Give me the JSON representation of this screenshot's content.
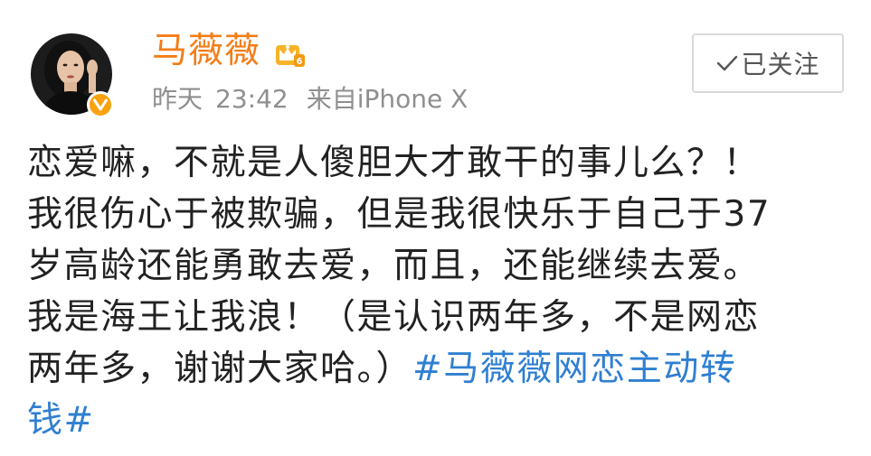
{
  "user": {
    "name": "马薇薇"
  },
  "meta": {
    "day": "昨天",
    "time": "23:42",
    "source": "来自iPhone X"
  },
  "follow": {
    "label": "已关注"
  },
  "content": {
    "line1": "恋爱嘛，不就是人傻胆大才敢干的事儿么？！",
    "line2": "我很伤心于被欺骗，但是我很快乐于自己于37",
    "line3": "岁高龄还能勇敢去爱，而且，还能继续去爱。",
    "line4": "我是海王让我浪！（是认识两年多，不是网恋",
    "line5_text": "两年多，谢谢大家哈。）",
    "line5_tag": "#马薇薇网恋主动转",
    "line6_tag": "钱#"
  },
  "colors": {
    "username": "#f47d18",
    "hashtag": "#2f7fd1",
    "meta": "#8f8f8f",
    "text": "#222222",
    "verify_badge": "#f8a20f"
  },
  "icons": {
    "crown": "crown-vip-icon",
    "verify": "verified-v-icon",
    "check": "check-icon"
  }
}
